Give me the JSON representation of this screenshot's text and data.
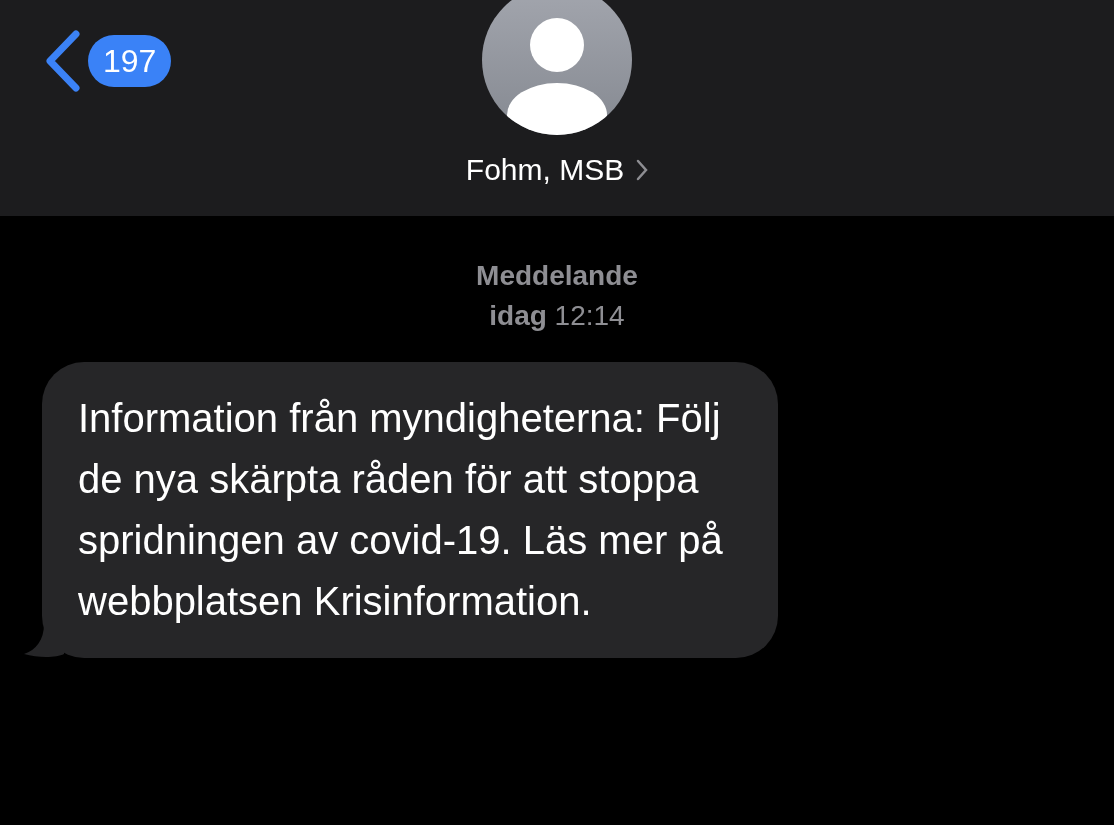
{
  "header": {
    "back_count": "197",
    "contact_name": "Fohm, MSB"
  },
  "conversation": {
    "service_label": "Meddelande",
    "timestamp": "**idag** 12:14",
    "messages": [
      {
        "kind": "incoming",
        "text": "Information från myndigheterna: Följ de nya skärpta råden för att stoppa spridningen av covid-19. Läs mer på webbplatsen Krisinformation."
      }
    ]
  }
}
